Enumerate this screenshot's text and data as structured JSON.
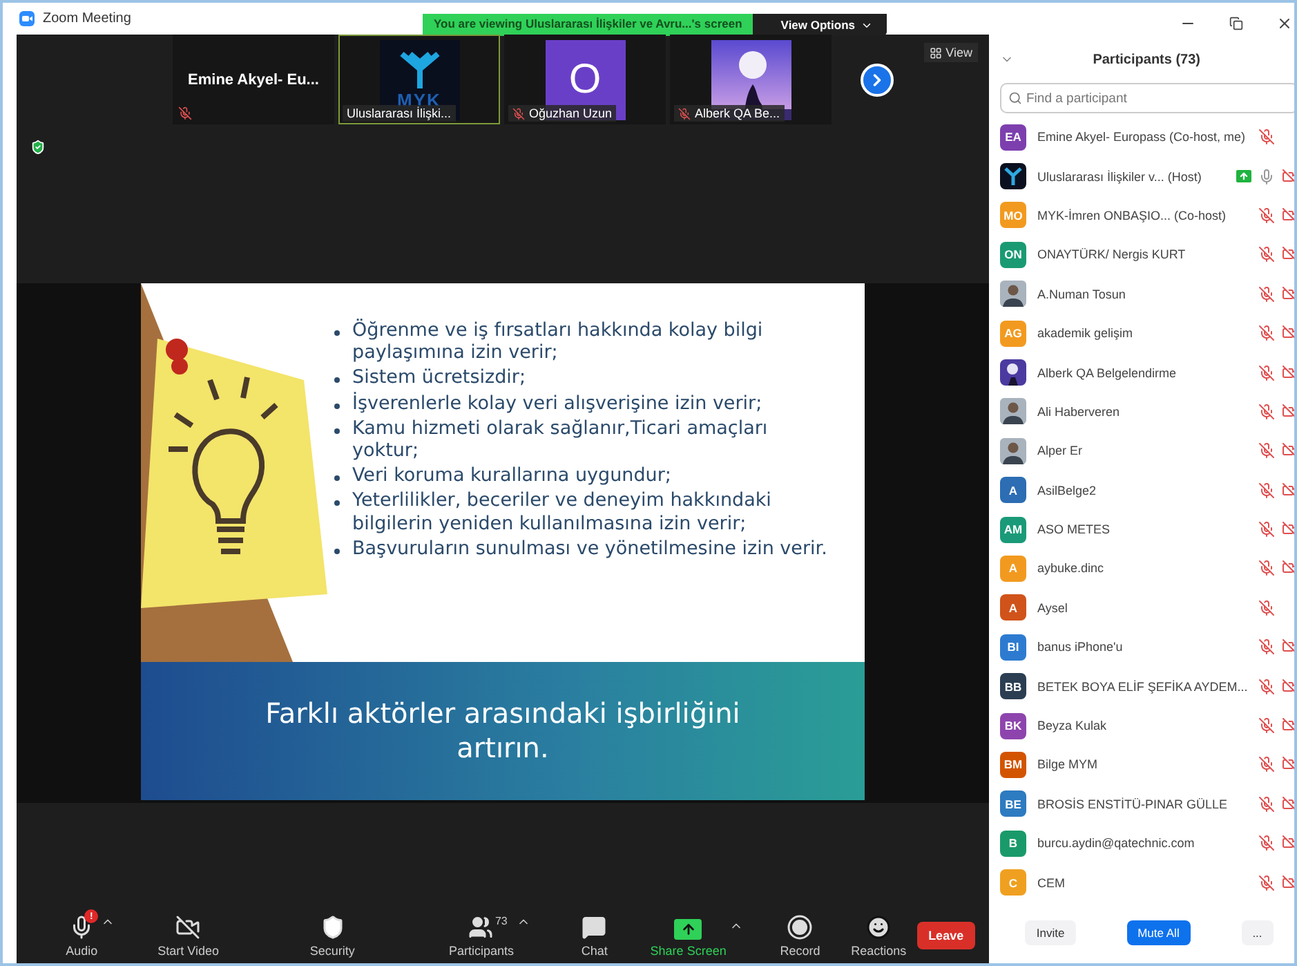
{
  "window": {
    "title": "Zoom Meeting"
  },
  "banner": {
    "text": "You are viewing Uluslararası İlişkiler ve Avru...'s screen",
    "button": "View Options"
  },
  "thumbnails": [
    {
      "kind": "name",
      "name": "Emine Akyel- Eu...",
      "muted": true,
      "speaking": false
    },
    {
      "kind": "logo",
      "logo_text": "MYK",
      "label": "Uluslararası İlişki...",
      "muted": false,
      "speaking": true
    },
    {
      "kind": "initial",
      "initial": "O",
      "label": "Oğuzhan Uzun",
      "muted": true,
      "speaking": false
    },
    {
      "kind": "picture",
      "label": "Alberk QA Be...",
      "muted": true,
      "speaking": false
    }
  ],
  "view_button": "View",
  "slide": {
    "bullets": [
      "Öğrenme ve iş fırsatları hakkında kolay bilgi paylaşımına izin verir;",
      "Sistem ücretsizdir;",
      "İşverenlerle kolay veri alışverişine izin verir;",
      "Kamu hizmeti olarak sağlanır,Ticari amaçları yoktur;",
      "Veri koruma kurallarına uygundur;",
      "Yeterlilikler, beceriler ve deneyim hakkındaki bilgilerin yeniden kullanılmasına izin verir;",
      "Başvuruların sunulması ve yönetilmesine izin verir."
    ],
    "footer": "Farklı aktörler arasındaki işbirliğini artırın."
  },
  "toolbar": [
    {
      "kind": "audio",
      "label": "Audio",
      "badge": "!",
      "caret": true,
      "active": false
    },
    {
      "kind": "video",
      "label": "Start Video",
      "caret": false,
      "active": false
    },
    {
      "kind": "security",
      "label": "Security",
      "caret": false,
      "active": false
    },
    {
      "kind": "participants",
      "label": "Participants",
      "count": "73",
      "caret": true,
      "active": false
    },
    {
      "kind": "chat",
      "label": "Chat",
      "caret": false,
      "active": false
    },
    {
      "kind": "share",
      "label": "Share Screen",
      "caret": true,
      "active": true
    },
    {
      "kind": "record",
      "label": "Record",
      "caret": false,
      "active": false
    },
    {
      "kind": "reactions",
      "label": "Reactions",
      "caret": false,
      "active": false
    }
  ],
  "leave_button": "Leave",
  "participants": {
    "title": "Participants (73)",
    "search": {
      "placeholder": "Find a participant"
    },
    "items": [
      {
        "kind": "initials",
        "initials": "EA",
        "color": "#7d3fae",
        "name": "Emine Akyel- Europass",
        "role": "(Co-host, me)",
        "muted": true,
        "video_off": false
      },
      {
        "kind": "logo",
        "name": "Uluslararası İlişkiler v...",
        "role": "(Host)",
        "sharing": true,
        "muted": false,
        "video_off": true
      },
      {
        "kind": "initials",
        "initials": "MO",
        "color": "#f29a1f",
        "name": "MYK-İmren ONBAŞIO...",
        "role": "(Co-host)",
        "muted": true,
        "video_off": true
      },
      {
        "kind": "initials",
        "initials": "ON",
        "color": "#1a9a72",
        "name": " ONAYTÜRK/ Nergis KURT",
        "muted": true,
        "video_off": true
      },
      {
        "name": "A.Numan Tosun",
        "muted": true,
        "video_off": true
      },
      {
        "kind": "initials",
        "initials": "AG",
        "color": "#f29a1f",
        "name": "akademik gelişim",
        "muted": true,
        "video_off": true
      },
      {
        "name": "Alberk QA Belgelendirme",
        "muted": true,
        "video_off": true
      },
      {
        "name": "Ali Haberveren",
        "muted": true,
        "video_off": true
      },
      {
        "name": "Alper Er",
        "muted": true,
        "video_off": true
      },
      {
        "kind": "initials",
        "initials": "A",
        "color": "#2c6db3",
        "name": "AsilBelge2",
        "muted": true,
        "video_off": true
      },
      {
        "kind": "initials",
        "initials": "AM",
        "color": "#1a9a78",
        "name": "ASO METES",
        "muted": true,
        "video_off": true
      },
      {
        "kind": "initials",
        "initials": "A",
        "color": "#f29a1f",
        "name": "aybuke.dinc",
        "muted": true,
        "video_off": true
      },
      {
        "kind": "initials",
        "initials": "A",
        "color": "#d0531a",
        "name": "Aysel",
        "muted": true,
        "video_off": false
      },
      {
        "kind": "initials",
        "initials": "BI",
        "color": "#2d7bd0",
        "name": "banus iPhone'u",
        "muted": true,
        "video_off": true
      },
      {
        "kind": "initials",
        "initials": "BB",
        "color": "#2b3e52",
        "name": "BETEK BOYA ELİF ŞEFİKA AYDEM...",
        "muted": true,
        "video_off": true
      },
      {
        "kind": "initials",
        "initials": "BK",
        "color": "#8e44ad",
        "name": "Beyza Kulak",
        "muted": true,
        "video_off": true
      },
      {
        "kind": "initials",
        "initials": "BM",
        "color": "#d35400",
        "name": "Bilge MYM",
        "muted": true,
        "video_off": true
      },
      {
        "kind": "initials",
        "initials": "BE",
        "color": "#2d7bc0",
        "name": "BROSİS ENSTİTÜ-PINAR GÜLLE",
        "muted": true,
        "video_off": true
      },
      {
        "kind": "initials",
        "initials": "B",
        "color": "#1a9a6a",
        "name": "burcu.aydin@qatechnic.com",
        "muted": true,
        "video_off": true
      },
      {
        "kind": "initials",
        "initials": "C",
        "color": "#f0a020",
        "name": "CEM",
        "muted": true,
        "video_off": true
      }
    ],
    "buttons": [
      {
        "kind": "plain",
        "label": "Invite"
      },
      {
        "kind": "primary",
        "label": "Mute All"
      },
      {
        "kind": "plain",
        "label": "..."
      }
    ]
  }
}
